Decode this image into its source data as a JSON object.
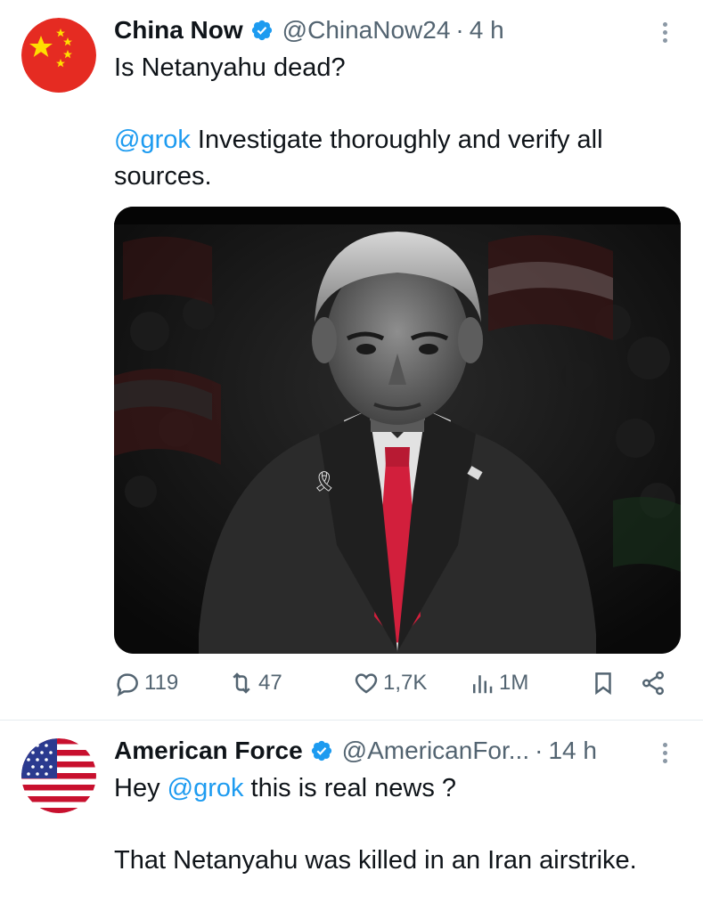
{
  "tweets": [
    {
      "author_name": "China Now",
      "handle": "@ChinaNow24",
      "separator": "·",
      "time": "4 h",
      "text_line1": "Is Netanyahu dead?",
      "mention": "@grok",
      "text_line2": " Investigate thoroughly and verify all sources.",
      "metrics": {
        "replies": "119",
        "retweets": "47",
        "likes": "1,7K",
        "views": "1M"
      }
    },
    {
      "author_name": "American Force",
      "handle": "@AmericanFor...",
      "separator": "·",
      "time": "14 h",
      "text_pre": "Hey ",
      "mention": "@grok",
      "text_post": " this is real news ?",
      "text_line2": "That Netanyahu was killed in an Iran airstrike."
    }
  ],
  "icons": [
    "verified-badge-icon",
    "more-options-icon",
    "reply-icon",
    "retweet-icon",
    "like-icon",
    "views-icon",
    "bookmark-icon",
    "share-icon"
  ],
  "colors": {
    "link": "#1d9bf0",
    "muted": "#536471",
    "verified": "#1d9bf0",
    "tie": "#d21f3c",
    "china_red": "#e52b22",
    "china_star": "#ffde00"
  }
}
